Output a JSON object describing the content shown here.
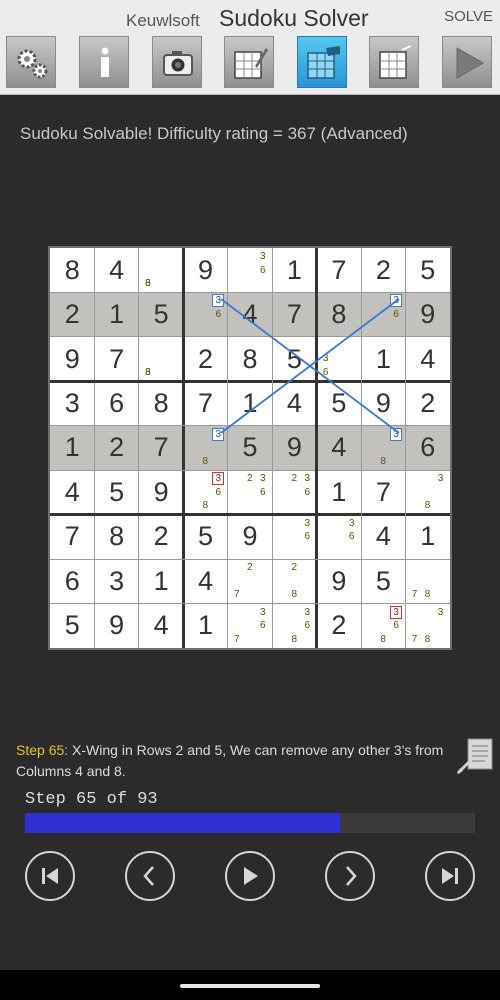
{
  "titlebar": {
    "app": "Keuwlsoft",
    "title": "Sudoku Solver",
    "solve_label": "SOLVE"
  },
  "toolbar": {
    "tools": [
      "settings-icon",
      "info-icon",
      "camera-icon",
      "edit-grid-icon",
      "solve-grid-icon",
      "clear-grid-icon",
      "play-icon"
    ],
    "active_tool": "solve-grid-icon"
  },
  "status": "Sudoku Solvable!  Difficulty rating = 367 (Advanced)",
  "board": {
    "values": [
      "84.9.1725",
      "215.478.9",
      "97.285.14",
      "36871459 2",
      "127.594.6",
      "459...17.",
      "78259..41",
      "6314..95.",
      "5941..2.."
    ],
    "gray_rows": [
      1,
      4
    ],
    "candidates": [
      [
        0,
        2,
        "3",
        6,
        "",
        ""
      ],
      [
        0,
        2,
        "6",
        6,
        "",
        ""
      ],
      [
        0,
        4,
        "3",
        2,
        "",
        ""
      ],
      [
        0,
        4,
        "6",
        5,
        "",
        ""
      ],
      [
        1,
        3,
        "3",
        2,
        "blue",
        ""
      ],
      [
        1,
        3,
        "6",
        5,
        "",
        ""
      ],
      [
        1,
        7,
        "3",
        2,
        "blue",
        ""
      ],
      [
        1,
        7,
        "6",
        5,
        "",
        ""
      ],
      [
        2,
        2,
        "3",
        6,
        "",
        ""
      ],
      [
        2,
        2,
        "6",
        6,
        "",
        ""
      ],
      [
        2,
        6,
        "3",
        3,
        "",
        ""
      ],
      [
        2,
        6,
        "6",
        6,
        "",
        ""
      ],
      [
        4,
        3,
        "3",
        2,
        "blue",
        ""
      ],
      [
        4,
        3,
        "8",
        7,
        "",
        ""
      ],
      [
        4,
        7,
        "3",
        2,
        "blue",
        ""
      ],
      [
        4,
        7,
        "8",
        7,
        "",
        ""
      ],
      [
        5,
        3,
        "3",
        2,
        "red",
        ""
      ],
      [
        5,
        3,
        "6",
        5,
        "",
        ""
      ],
      [
        5,
        3,
        "8",
        7,
        "",
        ""
      ],
      [
        5,
        4,
        "2",
        1,
        "",
        ""
      ],
      [
        5,
        4,
        "3",
        2,
        "",
        ""
      ],
      [
        5,
        4,
        "6",
        5,
        "",
        ""
      ],
      [
        5,
        5,
        "2",
        1,
        "",
        ""
      ],
      [
        5,
        5,
        "3",
        2,
        "",
        ""
      ],
      [
        5,
        5,
        "6",
        5,
        "",
        ""
      ],
      [
        5,
        8,
        "3",
        2,
        "",
        ""
      ],
      [
        5,
        8,
        "8",
        7,
        "",
        ""
      ],
      [
        6,
        5,
        "3",
        2,
        "",
        ""
      ],
      [
        6,
        5,
        "6",
        5,
        "",
        ""
      ],
      [
        6,
        6,
        "3",
        2,
        "",
        ""
      ],
      [
        6,
        6,
        "6",
        5,
        "",
        ""
      ],
      [
        7,
        4,
        "2",
        1,
        "",
        ""
      ],
      [
        7,
        4,
        "7",
        6,
        "",
        ""
      ],
      [
        7,
        5,
        "2",
        1,
        "",
        ""
      ],
      [
        7,
        5,
        "8",
        7,
        "",
        ""
      ],
      [
        7,
        8,
        "7",
        6,
        "",
        ""
      ],
      [
        7,
        8,
        "8",
        7,
        "",
        ""
      ],
      [
        8,
        4,
        "3",
        2,
        "",
        ""
      ],
      [
        8,
        4,
        "6",
        5,
        "",
        ""
      ],
      [
        8,
        4,
        "7",
        6,
        "",
        ""
      ],
      [
        8,
        5,
        "3",
        2,
        "",
        ""
      ],
      [
        8,
        5,
        "6",
        5,
        "",
        ""
      ],
      [
        8,
        5,
        "8",
        7,
        "",
        ""
      ],
      [
        8,
        7,
        "3",
        2,
        "red",
        ""
      ],
      [
        8,
        7,
        "6",
        5,
        "",
        ""
      ],
      [
        8,
        7,
        "8",
        7,
        "",
        ""
      ],
      [
        8,
        8,
        "3",
        2,
        "",
        ""
      ],
      [
        8,
        8,
        "7",
        6,
        "",
        ""
      ],
      [
        8,
        8,
        "8",
        7,
        "",
        ""
      ]
    ]
  },
  "step": {
    "label": "Step 65:",
    "description": " X-Wing in Rows 2 and 5, We can remove any other 3's from Columns 4 and 8.",
    "counter": "Step 65 of 93",
    "progress": 0.7
  },
  "nav": {
    "buttons": [
      "first-step-icon",
      "previous-step-icon",
      "play-icon",
      "next-step-icon",
      "last-step-icon"
    ]
  },
  "colors": {
    "progress_fill": "#2f2fd4",
    "step_label": "#e9c130",
    "active_tool": "#2a95d3",
    "xwing_line": "#3a78d0"
  }
}
